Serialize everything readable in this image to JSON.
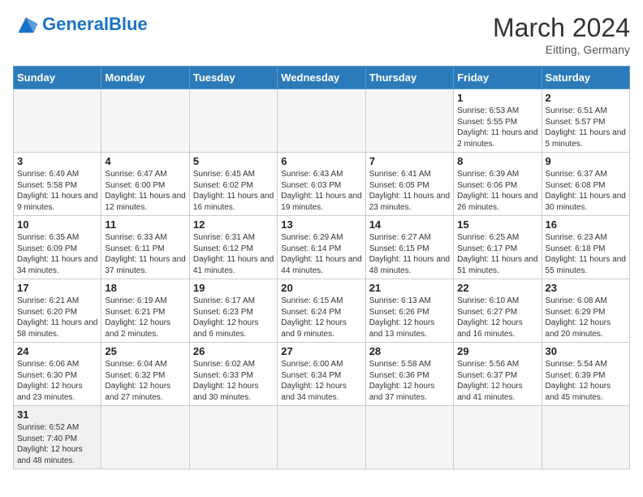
{
  "header": {
    "logo_general": "General",
    "logo_blue": "Blue",
    "month_year": "March 2024",
    "location": "Eitting, Germany"
  },
  "weekdays": [
    "Sunday",
    "Monday",
    "Tuesday",
    "Wednesday",
    "Thursday",
    "Friday",
    "Saturday"
  ],
  "weeks": [
    [
      {
        "day": "",
        "info": ""
      },
      {
        "day": "",
        "info": ""
      },
      {
        "day": "",
        "info": ""
      },
      {
        "day": "",
        "info": ""
      },
      {
        "day": "",
        "info": ""
      },
      {
        "day": "1",
        "info": "Sunrise: 6:53 AM\nSunset: 5:55 PM\nDaylight: 11 hours\nand 2 minutes."
      },
      {
        "day": "2",
        "info": "Sunrise: 6:51 AM\nSunset: 5:57 PM\nDaylight: 11 hours\nand 5 minutes."
      }
    ],
    [
      {
        "day": "3",
        "info": "Sunrise: 6:49 AM\nSunset: 5:58 PM\nDaylight: 11 hours\nand 9 minutes."
      },
      {
        "day": "4",
        "info": "Sunrise: 6:47 AM\nSunset: 6:00 PM\nDaylight: 11 hours\nand 12 minutes."
      },
      {
        "day": "5",
        "info": "Sunrise: 6:45 AM\nSunset: 6:02 PM\nDaylight: 11 hours\nand 16 minutes."
      },
      {
        "day": "6",
        "info": "Sunrise: 6:43 AM\nSunset: 6:03 PM\nDaylight: 11 hours\nand 19 minutes."
      },
      {
        "day": "7",
        "info": "Sunrise: 6:41 AM\nSunset: 6:05 PM\nDaylight: 11 hours\nand 23 minutes."
      },
      {
        "day": "8",
        "info": "Sunrise: 6:39 AM\nSunset: 6:06 PM\nDaylight: 11 hours\nand 26 minutes."
      },
      {
        "day": "9",
        "info": "Sunrise: 6:37 AM\nSunset: 6:08 PM\nDaylight: 11 hours\nand 30 minutes."
      }
    ],
    [
      {
        "day": "10",
        "info": "Sunrise: 6:35 AM\nSunset: 6:09 PM\nDaylight: 11 hours\nand 34 minutes."
      },
      {
        "day": "11",
        "info": "Sunrise: 6:33 AM\nSunset: 6:11 PM\nDaylight: 11 hours\nand 37 minutes."
      },
      {
        "day": "12",
        "info": "Sunrise: 6:31 AM\nSunset: 6:12 PM\nDaylight: 11 hours\nand 41 minutes."
      },
      {
        "day": "13",
        "info": "Sunrise: 6:29 AM\nSunset: 6:14 PM\nDaylight: 11 hours\nand 44 minutes."
      },
      {
        "day": "14",
        "info": "Sunrise: 6:27 AM\nSunset: 6:15 PM\nDaylight: 11 hours\nand 48 minutes."
      },
      {
        "day": "15",
        "info": "Sunrise: 6:25 AM\nSunset: 6:17 PM\nDaylight: 11 hours\nand 51 minutes."
      },
      {
        "day": "16",
        "info": "Sunrise: 6:23 AM\nSunset: 6:18 PM\nDaylight: 11 hours\nand 55 minutes."
      }
    ],
    [
      {
        "day": "17",
        "info": "Sunrise: 6:21 AM\nSunset: 6:20 PM\nDaylight: 11 hours\nand 58 minutes."
      },
      {
        "day": "18",
        "info": "Sunrise: 6:19 AM\nSunset: 6:21 PM\nDaylight: 12 hours\nand 2 minutes."
      },
      {
        "day": "19",
        "info": "Sunrise: 6:17 AM\nSunset: 6:23 PM\nDaylight: 12 hours\nand 6 minutes."
      },
      {
        "day": "20",
        "info": "Sunrise: 6:15 AM\nSunset: 6:24 PM\nDaylight: 12 hours\nand 9 minutes."
      },
      {
        "day": "21",
        "info": "Sunrise: 6:13 AM\nSunset: 6:26 PM\nDaylight: 12 hours\nand 13 minutes."
      },
      {
        "day": "22",
        "info": "Sunrise: 6:10 AM\nSunset: 6:27 PM\nDaylight: 12 hours\nand 16 minutes."
      },
      {
        "day": "23",
        "info": "Sunrise: 6:08 AM\nSunset: 6:29 PM\nDaylight: 12 hours\nand 20 minutes."
      }
    ],
    [
      {
        "day": "24",
        "info": "Sunrise: 6:06 AM\nSunset: 6:30 PM\nDaylight: 12 hours\nand 23 minutes."
      },
      {
        "day": "25",
        "info": "Sunrise: 6:04 AM\nSunset: 6:32 PM\nDaylight: 12 hours\nand 27 minutes."
      },
      {
        "day": "26",
        "info": "Sunrise: 6:02 AM\nSunset: 6:33 PM\nDaylight: 12 hours\nand 30 minutes."
      },
      {
        "day": "27",
        "info": "Sunrise: 6:00 AM\nSunset: 6:34 PM\nDaylight: 12 hours\nand 34 minutes."
      },
      {
        "day": "28",
        "info": "Sunrise: 5:58 AM\nSunset: 6:36 PM\nDaylight: 12 hours\nand 37 minutes."
      },
      {
        "day": "29",
        "info": "Sunrise: 5:56 AM\nSunset: 6:37 PM\nDaylight: 12 hours\nand 41 minutes."
      },
      {
        "day": "30",
        "info": "Sunrise: 5:54 AM\nSunset: 6:39 PM\nDaylight: 12 hours\nand 45 minutes."
      }
    ],
    [
      {
        "day": "31",
        "info": "Sunrise: 6:52 AM\nSunset: 7:40 PM\nDaylight: 12 hours\nand 48 minutes."
      },
      {
        "day": "",
        "info": ""
      },
      {
        "day": "",
        "info": ""
      },
      {
        "day": "",
        "info": ""
      },
      {
        "day": "",
        "info": ""
      },
      {
        "day": "",
        "info": ""
      },
      {
        "day": "",
        "info": ""
      }
    ]
  ]
}
